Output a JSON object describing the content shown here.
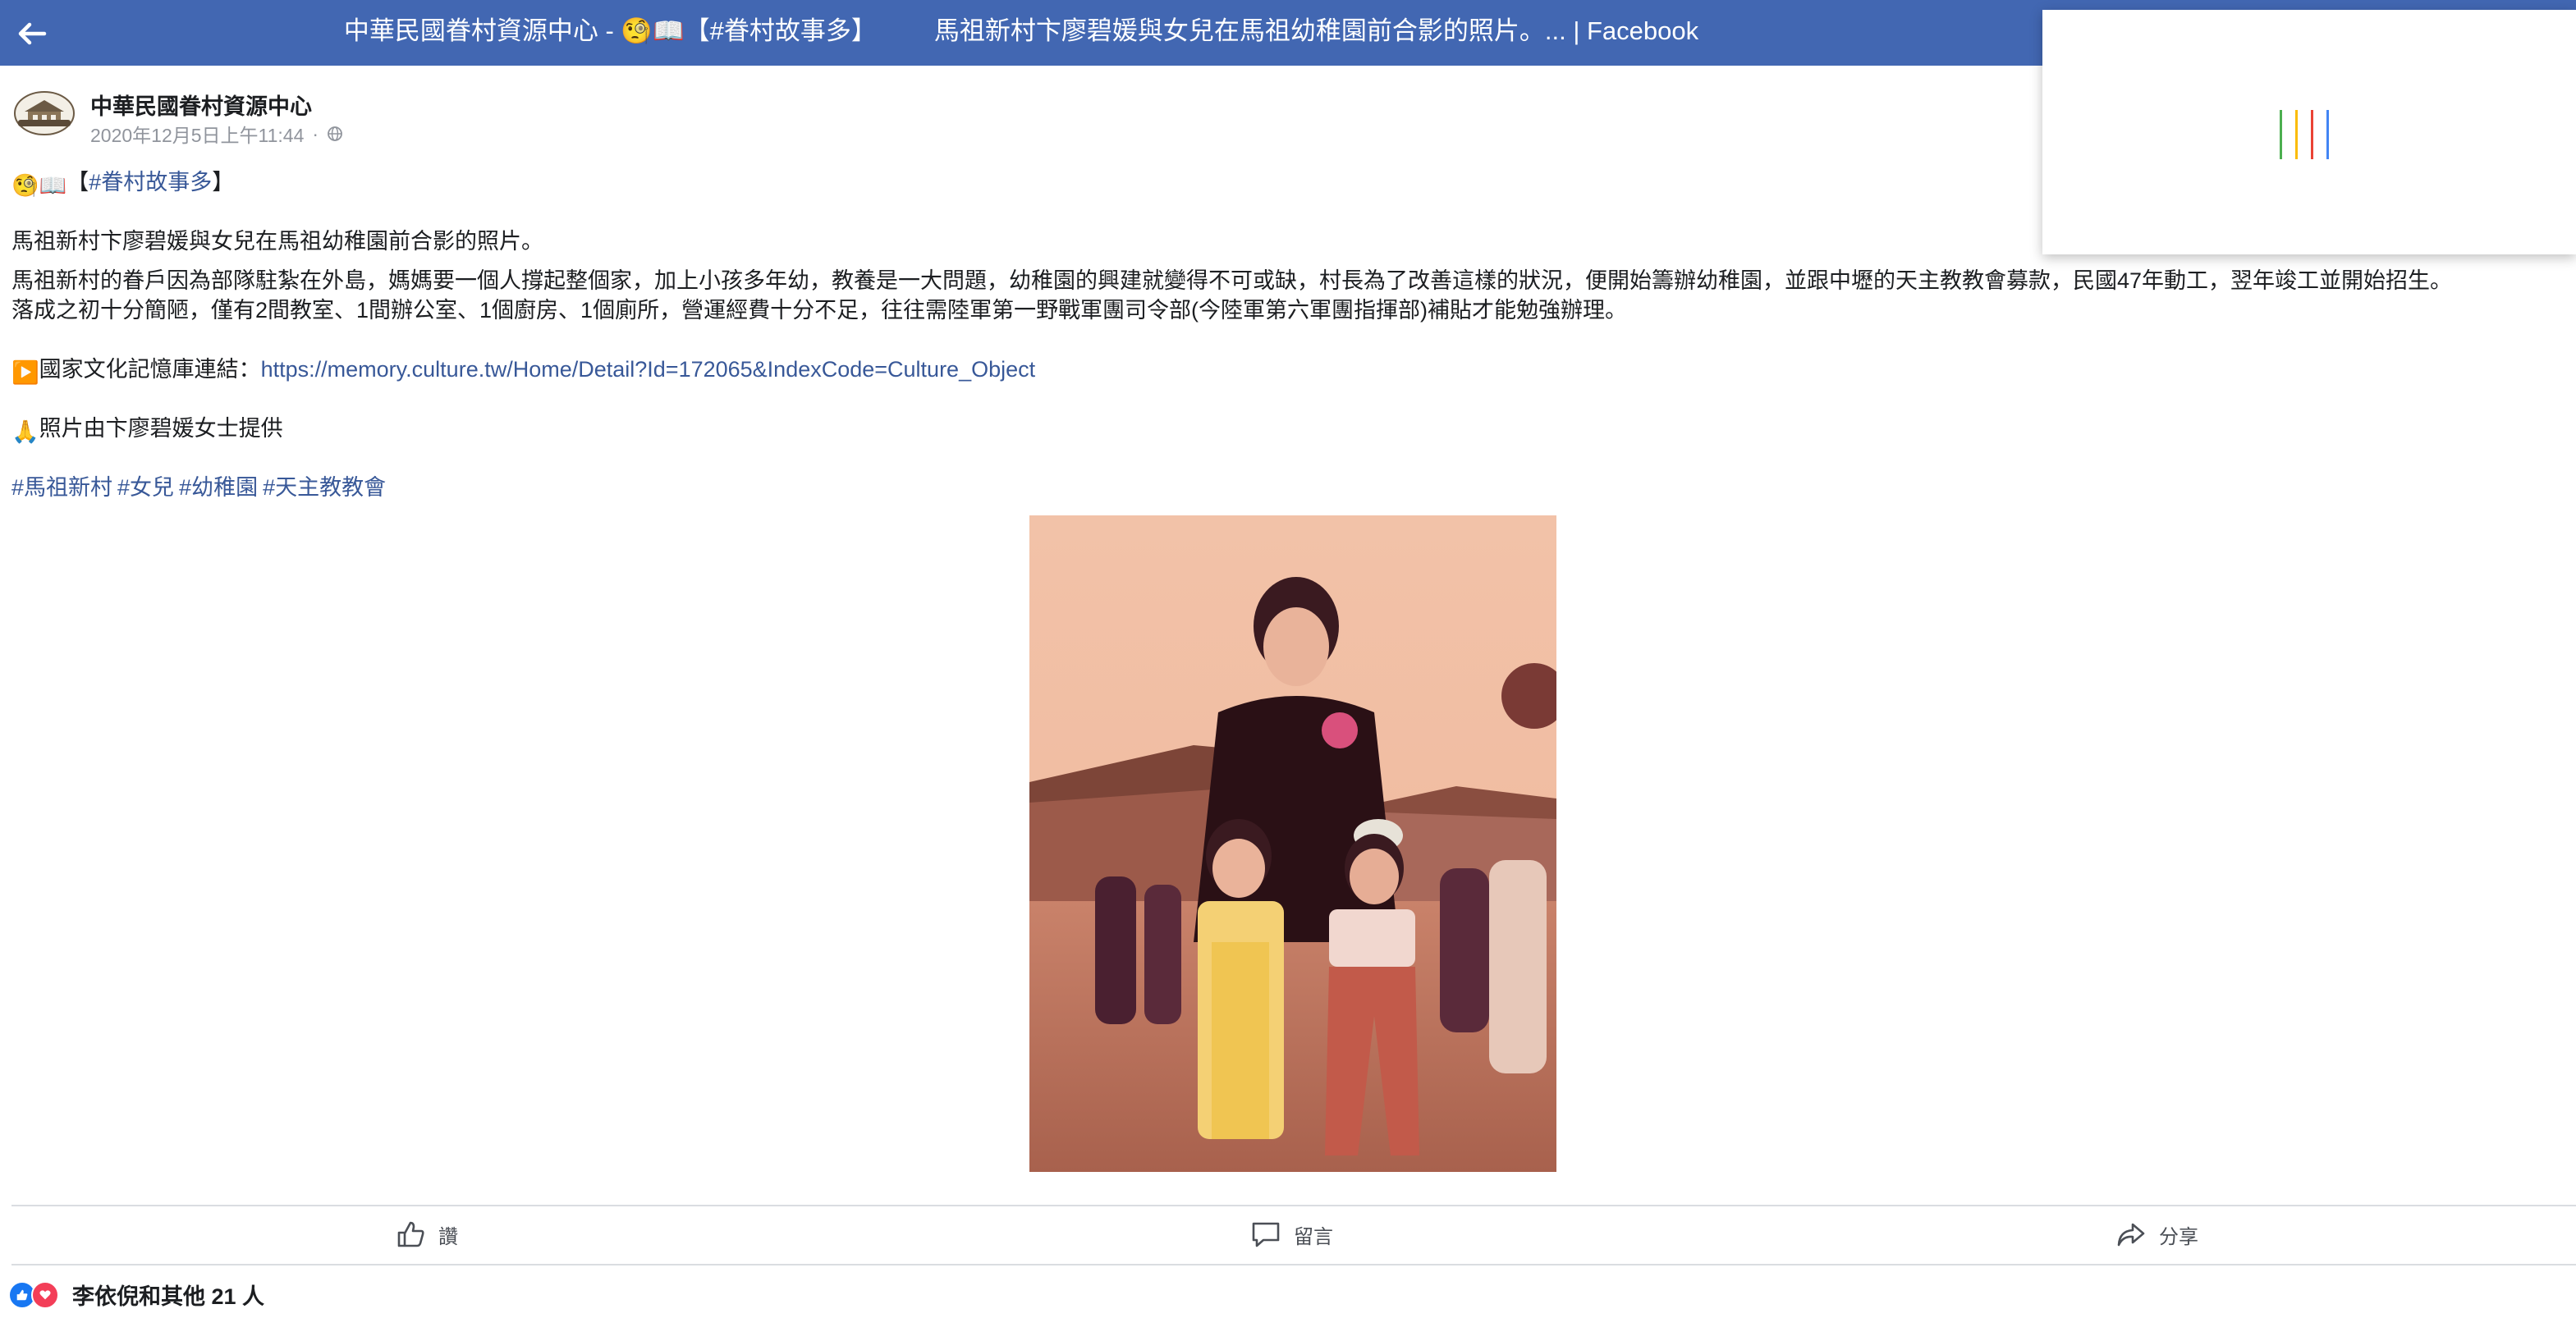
{
  "topbar": {
    "title_left": "中華民國眷村資源中心 - ",
    "title_emoji": "🧐📖",
    "title_tag": "【#眷村故事多】",
    "title_right": "馬祖新村卞廖碧媛與女兒在馬祖幼稚園前合影的照片。... | Facebook",
    "back_icon": "arrow-left-icon",
    "background_color": "#4267b2"
  },
  "loader": {
    "colors": [
      "#4caf50",
      "#fbbc05",
      "#ea4335",
      "#4285f4"
    ]
  },
  "post": {
    "page_name": "中華民國眷村資源中心",
    "timestamp": "2020年12月5日上午11:44",
    "separator": "·",
    "intro_emoji": "🧐📖",
    "intro_open": "【",
    "intro_tag": "#眷村故事多",
    "intro_close": "】",
    "headline": "馬祖新村卞廖碧媛與女兒在馬祖幼稚園前合影的照片。",
    "paragraph_1": "馬祖新村的眷戶因為部隊駐紮在外島，媽媽要一個人撐起整個家，加上小孩多年幼，教養是一大問題，幼稚園的興建就變得不可或缺，村長為了改善這樣的狀況，便開始籌辦幼稚園，並跟中壢的天主教教會募款，民國47年動工，翌年竣工並開始招生。",
    "paragraph_2": "落成之初十分簡陋，僅有2間教室、1間辦公室、1個廚房、1個廁所，營運經費十分不足，往往需陸軍第一野戰軍團司令部(今陸軍第六軍團指揮部)補貼才能勉強辦理。",
    "link_emoji": "▶️",
    "link_label": "國家文化記憶庫連結：",
    "link_url": "https://memory.culture.tw/Home/Detail?Id=172065&IndexCode=Culture_Object",
    "credit_emoji": "🙏",
    "credit": "照片由卞廖碧媛女士提供",
    "hashtags": [
      "#馬祖新村",
      "#女兒",
      "#幼稚園",
      "#天主教教會"
    ]
  },
  "actions": {
    "like": "讚",
    "comment": "留言",
    "share": "分享"
  },
  "reactions": {
    "summary": "李依倪和其他 21 人",
    "like_color": "#1877f2",
    "love_color": "#f33e58"
  }
}
